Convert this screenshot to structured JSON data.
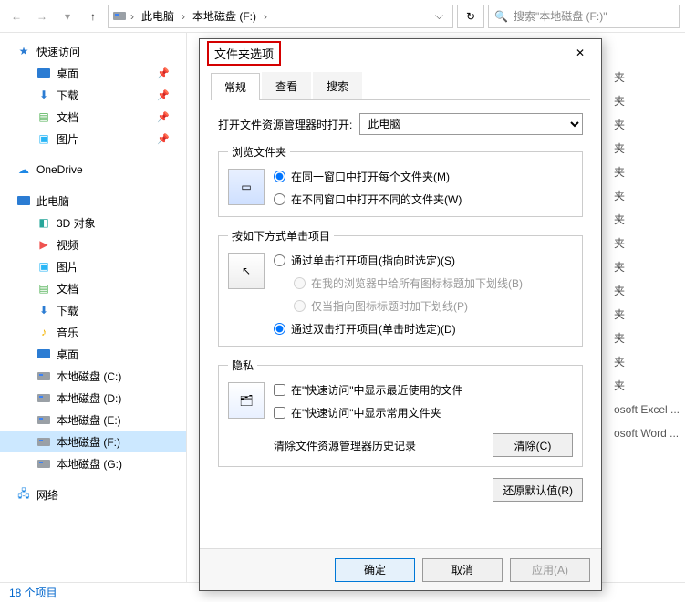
{
  "addressbar": {
    "segments": [
      "此电脑",
      "本地磁盘 (F:)"
    ],
    "search_placeholder": "搜索\"本地磁盘 (F:)\""
  },
  "sidebar": {
    "quick_access": "快速访问",
    "quick_items": [
      {
        "label": "桌面",
        "icon": "monitor",
        "pin": true
      },
      {
        "label": "下载",
        "icon": "download",
        "pin": true
      },
      {
        "label": "文档",
        "icon": "doc",
        "pin": true
      },
      {
        "label": "图片",
        "icon": "picture",
        "pin": true
      }
    ],
    "onedrive": "OneDrive",
    "this_pc": "此电脑",
    "pc_items": [
      {
        "label": "3D 对象"
      },
      {
        "label": "视频"
      },
      {
        "label": "图片"
      },
      {
        "label": "文档"
      },
      {
        "label": "下载"
      },
      {
        "label": "音乐"
      },
      {
        "label": "桌面"
      },
      {
        "label": "本地磁盘 (C:)"
      },
      {
        "label": "本地磁盘 (D:)"
      },
      {
        "label": "本地磁盘 (E:)"
      },
      {
        "label": "本地磁盘 (F:)",
        "selected": true
      },
      {
        "label": "本地磁盘 (G:)"
      }
    ],
    "network": "网络"
  },
  "content_hints": [
    "夹",
    "夹",
    "夹",
    "夹",
    "夹",
    "夹",
    "夹",
    "夹",
    "夹",
    "夹",
    "夹",
    "夹",
    "夹",
    "夹",
    "osoft Excel ...",
    "osoft Word ..."
  ],
  "statusbar": {
    "items_text": "18 个项目"
  },
  "dialog": {
    "title": "文件夹选项",
    "tabs": [
      "常规",
      "查看",
      "搜索"
    ],
    "open_label": "打开文件资源管理器时打开:",
    "open_value": "此电脑",
    "browse": {
      "legend": "浏览文件夹",
      "opt1": "在同一窗口中打开每个文件夹(M)",
      "opt2": "在不同窗口中打开不同的文件夹(W)"
    },
    "click": {
      "legend": "按如下方式单击项目",
      "opt1": "通过单击打开项目(指向时选定)(S)",
      "opt1a": "在我的浏览器中给所有图标标题加下划线(B)",
      "opt1b": "仅当指向图标标题时加下划线(P)",
      "opt2": "通过双击打开项目(单击时选定)(D)"
    },
    "privacy": {
      "legend": "隐私",
      "chk1": "在\"快速访问\"中显示最近使用的文件",
      "chk2": "在\"快速访问\"中显示常用文件夹",
      "clear_label": "清除文件资源管理器历史记录",
      "clear_btn": "清除(C)"
    },
    "restore_btn": "还原默认值(R)",
    "ok": "确定",
    "cancel": "取消",
    "apply": "应用(A)"
  }
}
